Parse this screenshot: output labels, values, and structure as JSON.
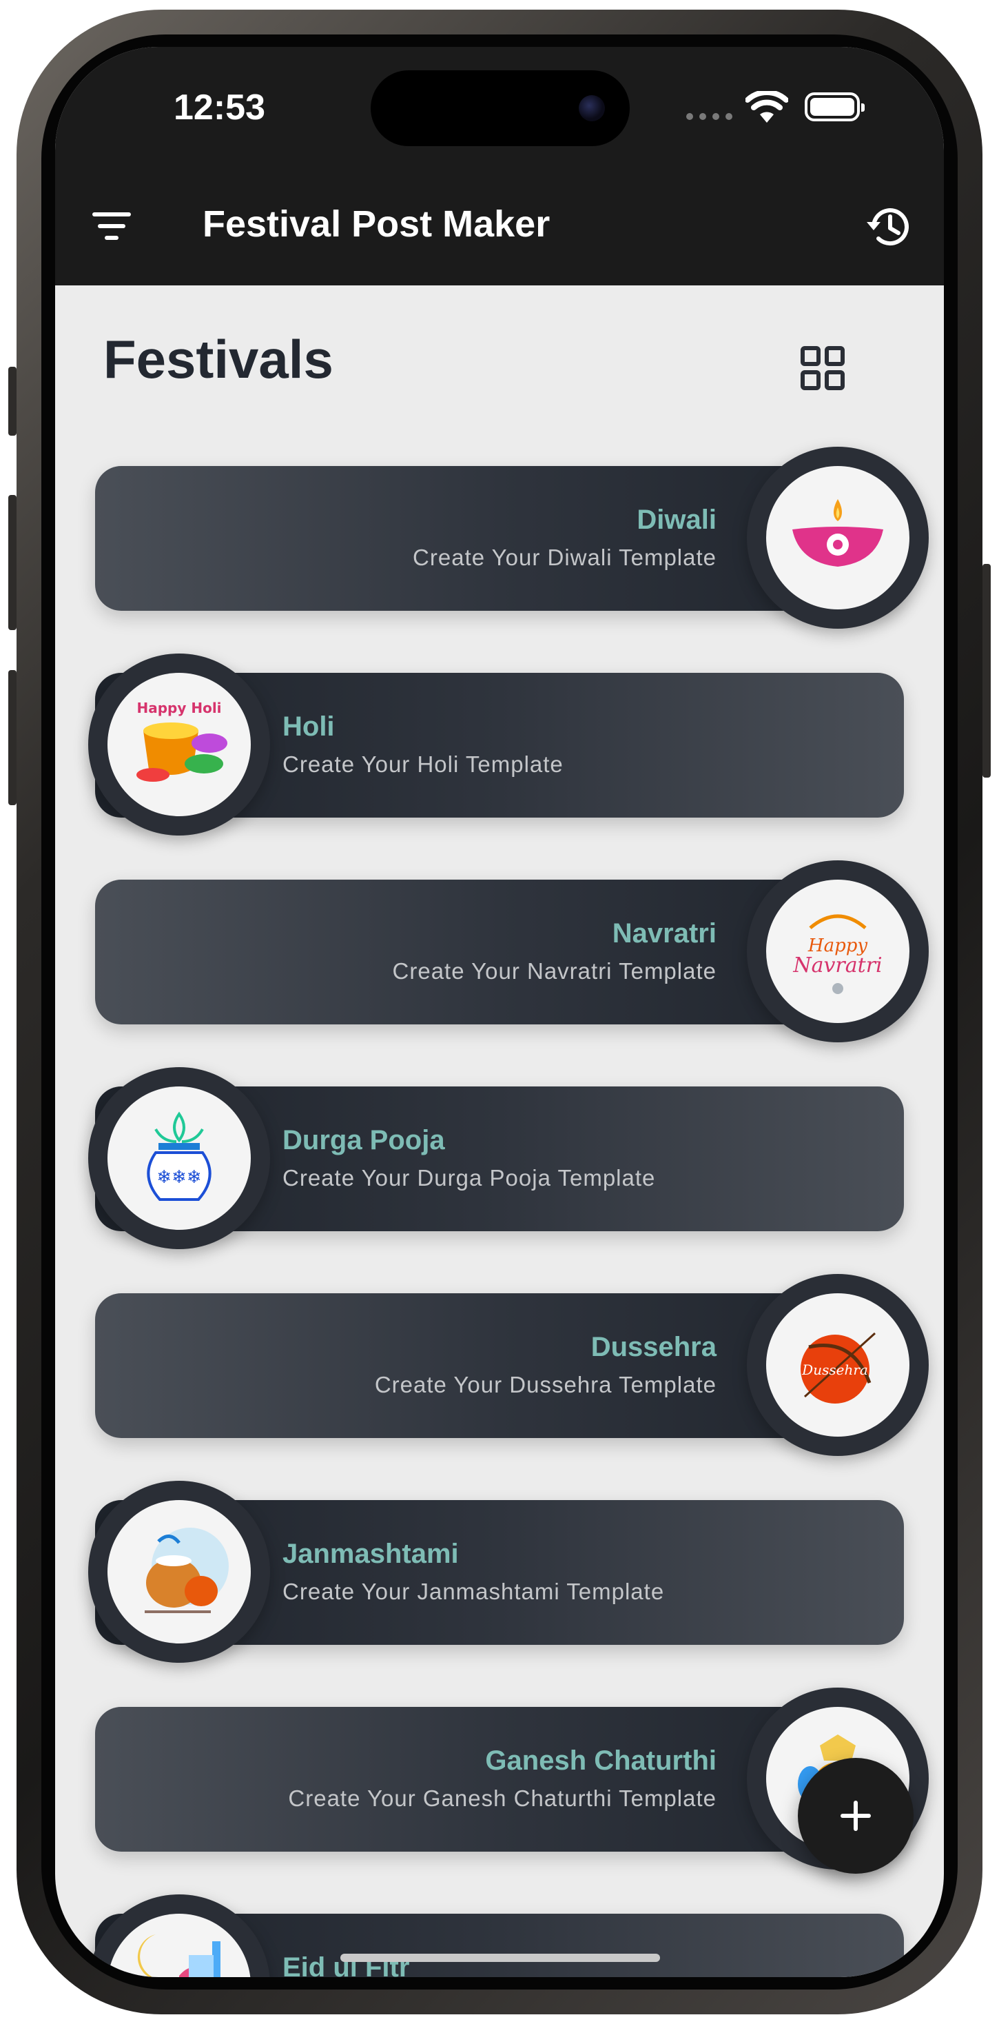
{
  "status_bar": {
    "time": "12:53"
  },
  "app_bar": {
    "title": "Festival Post Maker",
    "left_icon": "filter-icon",
    "right_icon": "history-icon"
  },
  "section": {
    "title": "Festivals",
    "view_toggle_icon": "grid-view-icon"
  },
  "festivals": [
    {
      "name": "Diwali",
      "subtitle": "Create Your Diwali Template",
      "image_icon": "diwali-diya-icon"
    },
    {
      "name": "Holi",
      "subtitle": "Create Your Holi Template",
      "image_icon": "holi-colors-icon"
    },
    {
      "name": "Navratri",
      "subtitle": "Create Your Navratri Template",
      "image_icon": "navratri-icon"
    },
    {
      "name": "Durga Pooja",
      "subtitle": "Create Your Durga Pooja Template",
      "image_icon": "kalash-icon"
    },
    {
      "name": "Dussehra",
      "subtitle": "Create Your Dussehra Template",
      "image_icon": "bow-arrow-icon"
    },
    {
      "name": "Janmashtami",
      "subtitle": "Create Your Janmashtami Template",
      "image_icon": "matki-icon"
    },
    {
      "name": "Ganesh Chaturthi",
      "subtitle": "Create Your Ganesh Chaturthi Template",
      "image_icon": "ganesh-icon"
    },
    {
      "name": "Eid ul Fitr",
      "subtitle": "",
      "image_icon": "moon-mosque-icon"
    }
  ],
  "fab": {
    "icon": "plus-icon"
  },
  "colors": {
    "topbar": "#1b1b1b",
    "card_title": "#7ebcb5",
    "background": "#ececec"
  }
}
